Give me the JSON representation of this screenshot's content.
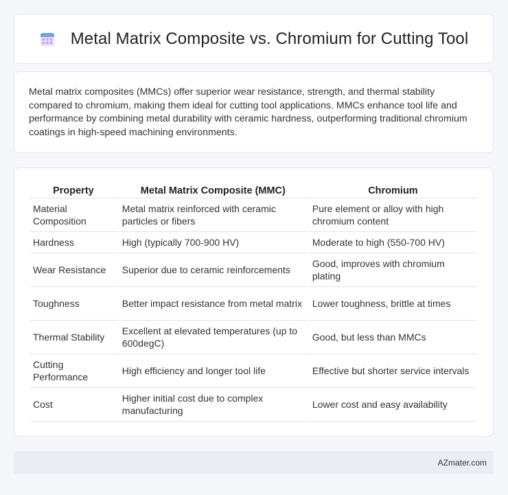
{
  "header": {
    "title": "Metal Matrix Composite vs. Chromium for Cutting Tool",
    "icon": "calendar-icon",
    "icon_colors": {
      "top": "#6fa0ee",
      "body": "#e9ddf7",
      "dots": "#b89ae6"
    }
  },
  "intro": {
    "text": "Metal matrix composites (MMCs) offer superior wear resistance, strength, and thermal stability compared to chromium, making them ideal for cutting tool applications. MMCs enhance tool life and performance by combining metal durability with ceramic hardness, outperforming traditional chromium coatings in high-speed machining environments."
  },
  "table": {
    "headers": [
      "Property",
      "Metal Matrix Composite (MMC)",
      "Chromium"
    ],
    "rows": [
      [
        "Material Composition",
        "Metal matrix reinforced with ceramic particles or fibers",
        "Pure element or alloy with high chromium content"
      ],
      [
        "Hardness",
        "High (typically 700-900 HV)",
        "Moderate to high (550-700 HV)"
      ],
      [
        "Wear Resistance",
        "Superior due to ceramic reinforcements",
        "Good, improves with chromium plating"
      ],
      [
        "Toughness",
        "Better impact resistance from metal matrix",
        "Lower toughness, brittle at times"
      ],
      [
        "Thermal Stability",
        "Excellent at elevated temperatures (up to 600degC)",
        "Good, but less than MMCs"
      ],
      [
        "Cutting Performance",
        "High efficiency and longer tool life",
        "Effective but shorter service intervals"
      ],
      [
        "Cost",
        "Higher initial cost due to complex manufacturing",
        "Lower cost and easy availability"
      ]
    ]
  },
  "footer": {
    "text": "AZmater.com"
  }
}
